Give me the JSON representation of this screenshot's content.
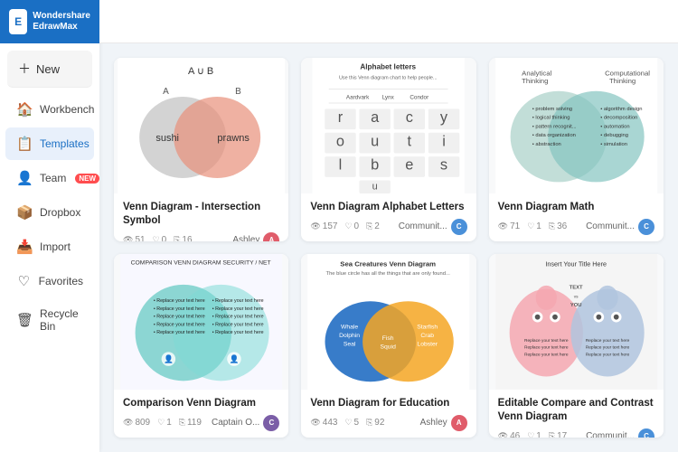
{
  "app": {
    "logo_line1": "Wondershare",
    "logo_line2": "EdrawMax"
  },
  "sidebar": {
    "new_label": "New",
    "items": [
      {
        "id": "workbench",
        "label": "Workbench",
        "icon": "🏠"
      },
      {
        "id": "templates",
        "label": "Templates",
        "icon": "📋",
        "active": true
      },
      {
        "id": "team",
        "label": "Team",
        "icon": "👤",
        "badge": "NEW"
      },
      {
        "id": "dropbox",
        "label": "Dropbox",
        "icon": "📦"
      },
      {
        "id": "import",
        "label": "Import",
        "icon": "📥"
      },
      {
        "id": "favorites",
        "label": "Favorites",
        "icon": "♡"
      },
      {
        "id": "recycle",
        "label": "Recycle Bin",
        "icon": "🗑"
      }
    ]
  },
  "cards": [
    {
      "id": "card1",
      "title": "Venn Diagram - Intersection Symbol",
      "type": "venn-intersection",
      "stats": {
        "views": "51",
        "likes": "0",
        "copies": "16"
      },
      "author": "Ashley",
      "author_color": "#e05c6a",
      "author_initial": "A",
      "community": false
    },
    {
      "id": "card2",
      "title": "Venn Diagram Alphabet Letters",
      "type": "venn-alphabet",
      "stats": {
        "views": "157",
        "likes": "0",
        "copies": "2"
      },
      "author": "Communit...",
      "author_color": "#4a90d9",
      "author_initial": "C",
      "community": true
    },
    {
      "id": "card3",
      "title": "Venn Diagram Math",
      "type": "venn-math",
      "stats": {
        "views": "71",
        "likes": "1",
        "copies": "36"
      },
      "author": "Communit...",
      "author_color": "#4a90d9",
      "author_initial": "C",
      "community": true
    },
    {
      "id": "card4",
      "title": "Comparison Venn Diagram",
      "type": "venn-comparison",
      "stats": {
        "views": "809",
        "likes": "1",
        "copies": "119"
      },
      "author": "Captain O...",
      "author_color": "#7b5ea7",
      "author_initial": "C",
      "community": true
    },
    {
      "id": "card5",
      "title": "Venn Diagram for Education",
      "type": "venn-education",
      "stats": {
        "views": "443",
        "likes": "5",
        "copies": "92"
      },
      "author": "Ashley",
      "author_color": "#e05c6a",
      "author_initial": "A",
      "community": false
    },
    {
      "id": "card6",
      "title": "Editable Compare and Contrast Venn Diagram",
      "type": "venn-contrast",
      "stats": {
        "views": "46",
        "likes": "1",
        "copies": "17"
      },
      "author": "Communit...",
      "author_color": "#4a90d9",
      "author_initial": "C",
      "community": true
    }
  ]
}
